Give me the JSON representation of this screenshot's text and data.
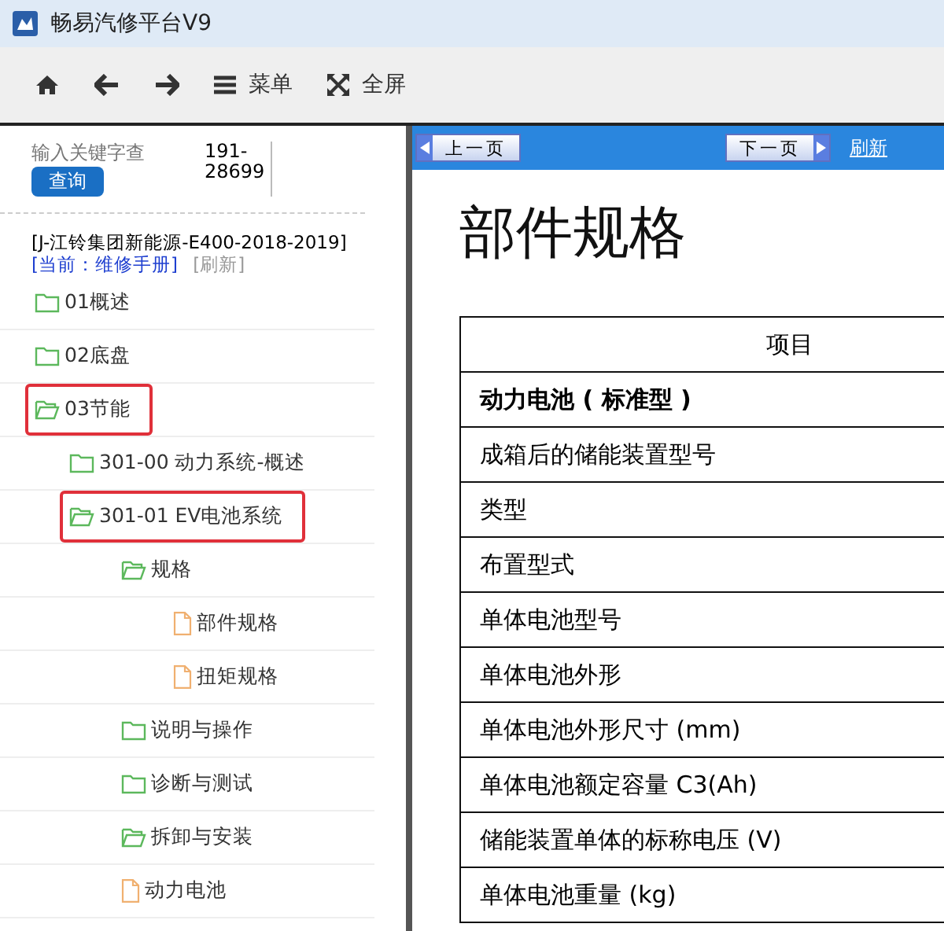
{
  "window": {
    "title": "畅易汽修平台V9"
  },
  "toolbar": [
    {
      "kind": "home"
    },
    {
      "kind": "back"
    },
    {
      "kind": "forward"
    },
    {
      "kind": "menu",
      "label": "菜单"
    },
    {
      "kind": "fullscreen",
      "label": "全屏"
    }
  ],
  "sidebar": {
    "search": {
      "placeholder": "输入关键字查"
    },
    "code": "191-28699",
    "search_button": "查询",
    "vehicle": "[J-江铃集团新能源-E400-2018-2019]",
    "current": "[当前：维修手册]",
    "refresh": "[刷新]",
    "tree": [
      {
        "label": "01概述",
        "kind": "folder",
        "expanded": false,
        "highlighted": false
      },
      {
        "label": "02底盘",
        "kind": "folder",
        "expanded": false,
        "highlighted": false
      },
      {
        "label": "03节能",
        "kind": "folder",
        "expanded": true,
        "highlighted": true,
        "children": [
          {
            "label": "301-00 动力系统-概述",
            "kind": "folder",
            "expanded": false,
            "highlighted": false
          },
          {
            "label": "301-01 EV电池系统",
            "kind": "folder",
            "expanded": true,
            "highlighted": true,
            "children": [
              {
                "label": "规格",
                "kind": "folder",
                "expanded": true,
                "highlighted": false,
                "children": [
                  {
                    "label": "部件规格",
                    "kind": "doc",
                    "highlighted": false
                  },
                  {
                    "label": "扭矩规格",
                    "kind": "doc",
                    "highlighted": false
                  }
                ]
              },
              {
                "label": "说明与操作",
                "kind": "folder",
                "expanded": false,
                "highlighted": false
              },
              {
                "label": "诊断与测试",
                "kind": "folder",
                "expanded": false,
                "highlighted": false
              },
              {
                "label": "拆卸与安装",
                "kind": "folder",
                "expanded": true,
                "highlighted": false
              },
              {
                "label": "动力电池",
                "kind": "doc",
                "highlighted": false
              }
            ]
          }
        ]
      }
    ]
  },
  "viewer": {
    "prev": "上一页",
    "next": "下一页",
    "refresh": "刷新",
    "heading": "部件规格",
    "table": {
      "columns": [
        "项目"
      ],
      "rows": [
        {
          "text": "动力电池 ( 标准型 )",
          "bold": true
        },
        {
          "text": "成箱后的储能装置型号",
          "bold": false
        },
        {
          "text": "类型",
          "bold": false
        },
        {
          "text": "布置型式",
          "bold": false
        },
        {
          "text": "单体电池型号",
          "bold": false
        },
        {
          "text": "单体电池外形",
          "bold": false
        },
        {
          "text": "单体电池外形尺寸 (mm)",
          "bold": false
        },
        {
          "text": "单体电池额定容量 C3(Ah)",
          "bold": false
        },
        {
          "text": "储能装置单体的标称电压 (V)",
          "bold": false
        },
        {
          "text": "单体电池重量 (kg)",
          "bold": false
        }
      ]
    }
  }
}
